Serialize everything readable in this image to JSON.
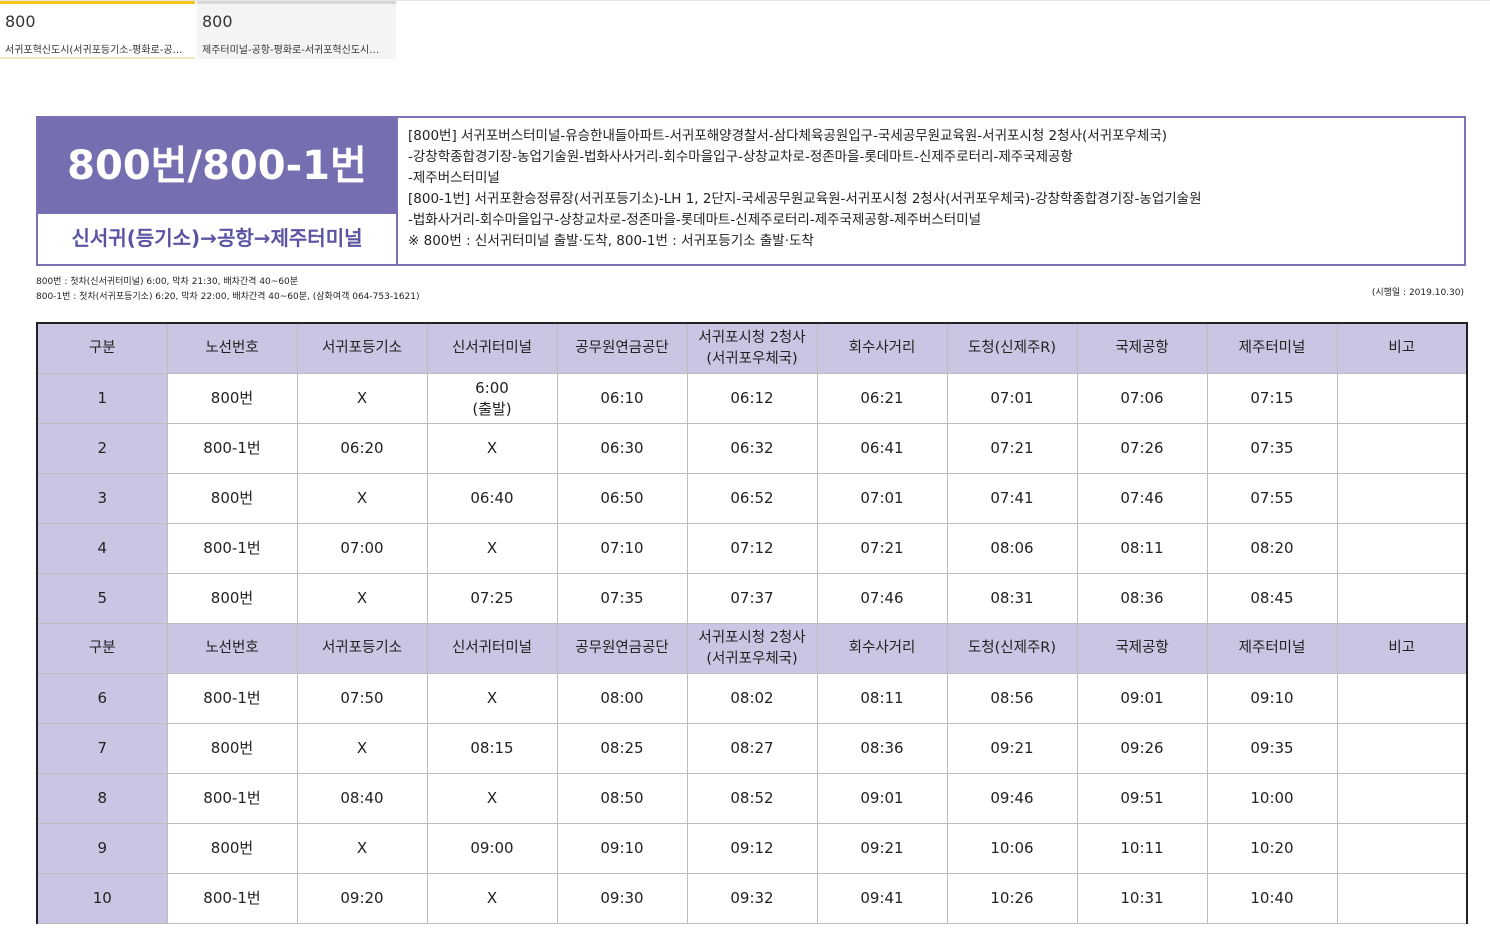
{
  "tabs": [
    {
      "number": "800",
      "description": "서귀포혁신도시(서귀포등기소-평화로-공…"
    },
    {
      "number": "800",
      "description": "제주터미널-공항-평화로-서귀포혁신도시…"
    }
  ],
  "route": {
    "number": "800번/800-1번",
    "direction": "신서귀(등기소)→공항→제주터미널",
    "description_lines": [
      "[800번] 서귀포버스터미널-유승한내들아파트-서귀포해양경찰서-삼다체육공원입구-국세공무원교육원-서귀포시청 2청사(서귀포우체국)",
      "-강창학종합경기장-농업기술원-법화사사거리-회수마을입구-상창교차로-정존마을-롯데마트-신제주로터리-제주국제공항",
      "-제주버스터미널",
      "[800-1번] 서귀포환승정류장(서귀포등기소)-LH 1, 2단지-국세공무원교육원-서귀포시청 2청사(서귀포우체국)-강창학종합경기장-농업기술원",
      "-법화사거리-회수마을입구-상창교차로-정존마을-롯데마트-신제주로터리-제주국제공항-제주버스터미널",
      "※ 800번 : 신서귀터미널 출발·도착, 800-1번 : 서귀포등기소 출발·도착"
    ]
  },
  "notes": [
    "800번 : 첫차(신서귀터미널) 6:00, 막차 21:30, 배차간격 40~60분",
    "800-1번 : 첫차(서귀포등기소) 6:20, 막차 22:00, 배차간격 40~60분, (삼화여객 064-753-1621)"
  ],
  "effective_date": "(시행일 : 2019.10.30)",
  "table": {
    "headers": [
      "구분",
      "노선번호",
      "서귀포등기소",
      "신서귀터미널",
      "공무원연금공단",
      "서귀포시청 2청사\n(서귀포우체국)",
      "회수사거리",
      "도청(신제주R)",
      "국제공항",
      "제주터미널",
      "비고"
    ],
    "group1": [
      [
        "1",
        "800번",
        "X",
        "6:00\n(출발)",
        "06:10",
        "06:12",
        "06:21",
        "07:01",
        "07:06",
        "07:15",
        ""
      ],
      [
        "2",
        "800-1번",
        "06:20",
        "X",
        "06:30",
        "06:32",
        "06:41",
        "07:21",
        "07:26",
        "07:35",
        ""
      ],
      [
        "3",
        "800번",
        "X",
        "06:40",
        "06:50",
        "06:52",
        "07:01",
        "07:41",
        "07:46",
        "07:55",
        ""
      ],
      [
        "4",
        "800-1번",
        "07:00",
        "X",
        "07:10",
        "07:12",
        "07:21",
        "08:06",
        "08:11",
        "08:20",
        ""
      ],
      [
        "5",
        "800번",
        "X",
        "07:25",
        "07:35",
        "07:37",
        "07:46",
        "08:31",
        "08:36",
        "08:45",
        ""
      ]
    ],
    "group2": [
      [
        "6",
        "800-1번",
        "07:50",
        "X",
        "08:00",
        "08:02",
        "08:11",
        "08:56",
        "09:01",
        "09:10",
        ""
      ],
      [
        "7",
        "800번",
        "X",
        "08:15",
        "08:25",
        "08:27",
        "08:36",
        "09:21",
        "09:26",
        "09:35",
        ""
      ],
      [
        "8",
        "800-1번",
        "08:40",
        "X",
        "08:50",
        "08:52",
        "09:01",
        "09:46",
        "09:51",
        "10:00",
        ""
      ],
      [
        "9",
        "800번",
        "X",
        "09:00",
        "09:10",
        "09:12",
        "09:21",
        "10:06",
        "10:11",
        "10:20",
        ""
      ],
      [
        "10",
        "800-1번",
        "09:20",
        "X",
        "09:30",
        "09:32",
        "09:41",
        "10:26",
        "10:31",
        "10:40",
        ""
      ]
    ]
  },
  "colors": {
    "accent_purple": "#756fb1",
    "header_cell": "#c9c6e3",
    "active_tab": "#f5c518"
  }
}
